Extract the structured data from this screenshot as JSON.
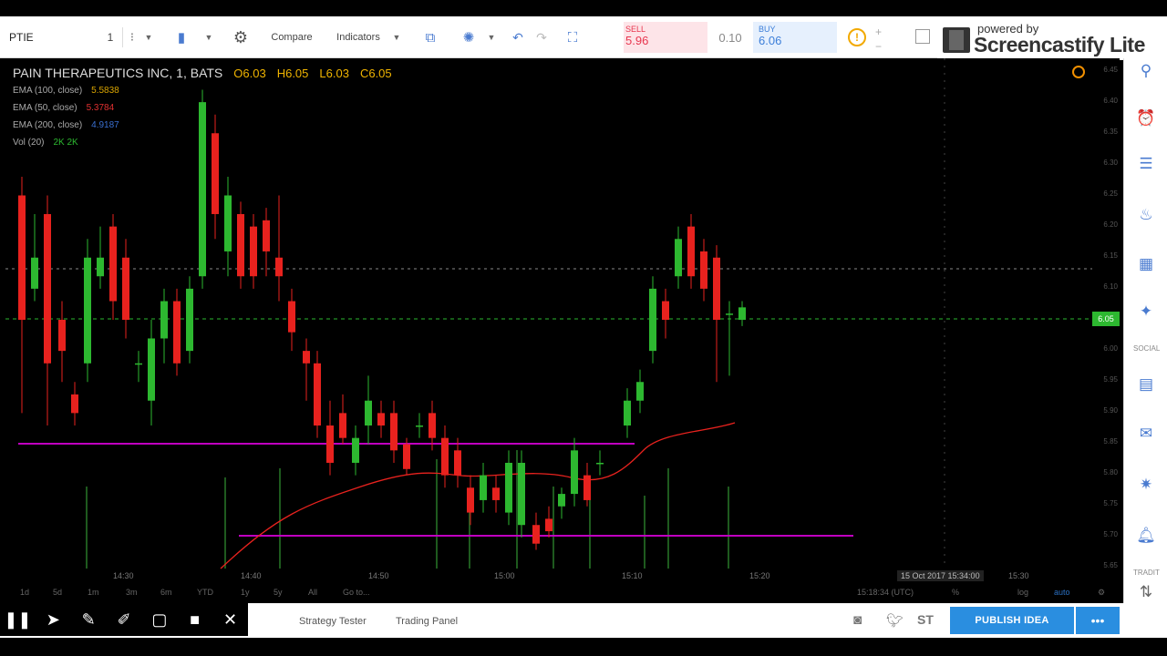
{
  "toolbar": {
    "symbol": "PTIE",
    "interval": "1",
    "compare_label": "Compare",
    "indicators_label": "Indicators",
    "sell": {
      "label": "SELL",
      "price": "5.96"
    },
    "spread": "0.10",
    "buy": {
      "label": "BUY",
      "price": "6.06"
    }
  },
  "watermark": {
    "powered_by": "powered by",
    "brand": "Screencastify Lite"
  },
  "chart": {
    "title": "PAIN THERAPEUTICS INC, 1, BATS",
    "ohlc": {
      "o": "O6.03",
      "h": "H6.05",
      "l": "L6.03",
      "c": "C6.05"
    },
    "indicators": [
      {
        "label": "EMA (100, close)",
        "value": "5.5838",
        "color": "#d9a400"
      },
      {
        "label": "EMA (50, close)",
        "value": "5.3784",
        "color": "#e03030"
      },
      {
        "label": "EMA (200, close)",
        "value": "4.9187",
        "color": "#3a6fd0"
      },
      {
        "label": "Vol (20)",
        "value": "2K 2K",
        "color": "#2db830"
      }
    ],
    "price_ticks": [
      "6.45",
      "6.40",
      "6.35",
      "6.30",
      "6.25",
      "6.20",
      "6.15",
      "6.10",
      "6.05",
      "6.00",
      "5.95",
      "5.90",
      "5.85",
      "5.80",
      "5.75",
      "5.70",
      "5.65"
    ],
    "current_price_badge": "6.05",
    "time_ticks": [
      "14:30",
      "14:40",
      "14:50",
      "15:00",
      "15:10",
      "15:20",
      "15:30"
    ],
    "crosshair_time": "15 Oct 2017 15:34:00",
    "colors": {
      "up": "#2db830",
      "down": "#e8221e",
      "ema": "#e8221e",
      "hline": "#c000c0",
      "crosshair": "#888888"
    }
  },
  "range_bar": {
    "items": [
      "1d",
      "5d",
      "1m",
      "3m",
      "6m",
      "YTD",
      "1y",
      "5y",
      "All",
      "Go to..."
    ],
    "utc_time": "15:18:34 (UTC)",
    "pct": "%",
    "log": "log",
    "auto": "auto"
  },
  "bottom": {
    "tabs": [
      "Strategy Tester",
      "Trading Panel"
    ],
    "publish_label": "PUBLISH IDEA",
    "more_label": "•••",
    "st_label": "ST"
  },
  "rail": {
    "social_label": "SOCIAL",
    "tradit_label": "TRADIT"
  },
  "rec_toolbar": {
    "icons": [
      "pause-icon",
      "pointer-icon",
      "pen-icon",
      "highlighter-icon",
      "rectangle-icon",
      "camera-icon",
      "close-icon"
    ]
  }
}
